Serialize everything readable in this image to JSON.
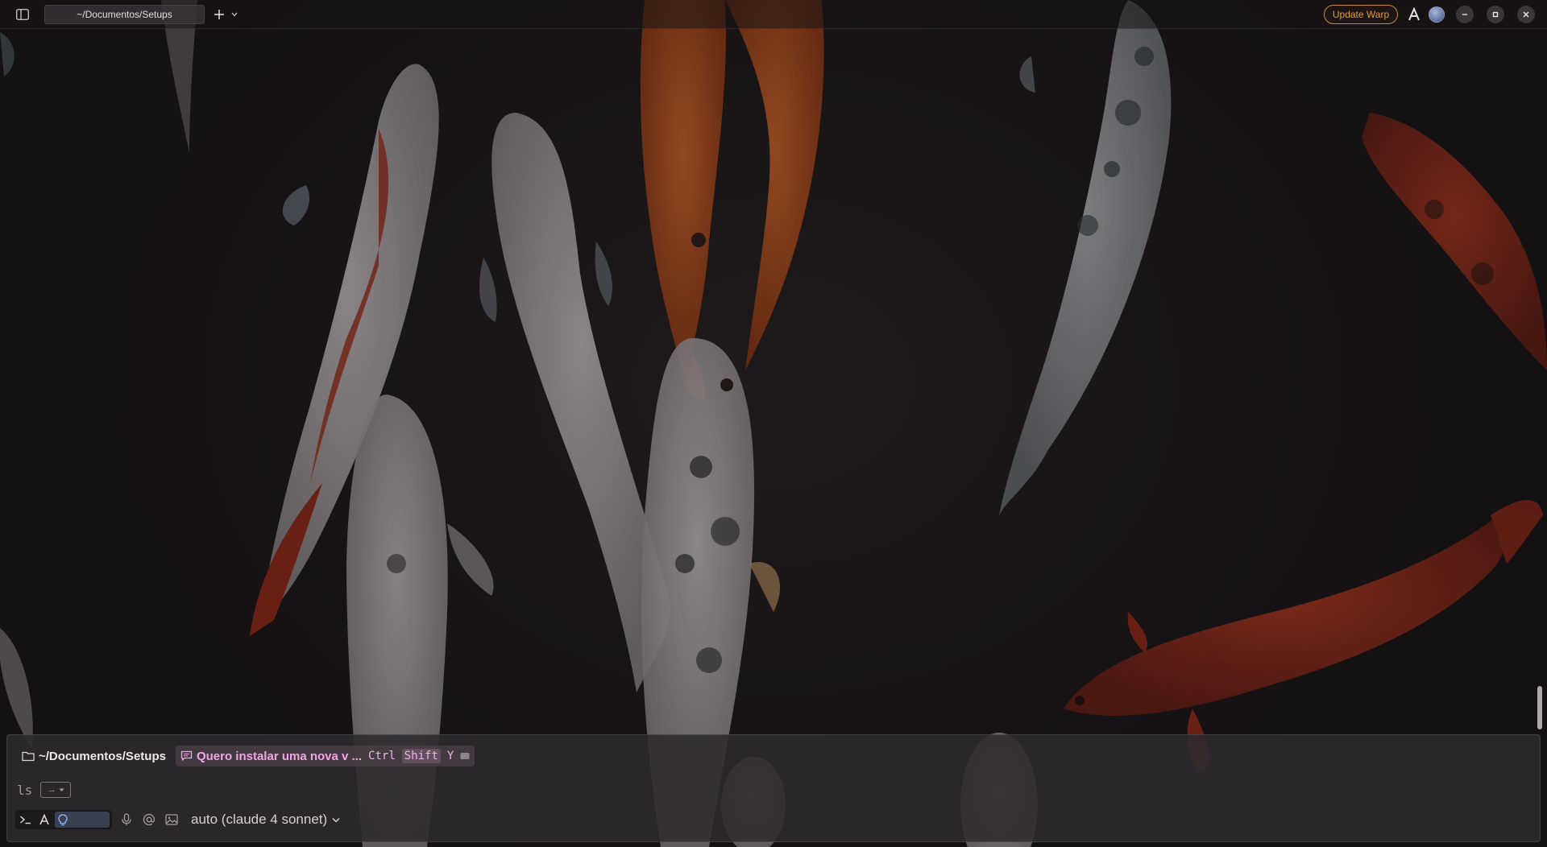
{
  "titlebar": {
    "tab_title": "~/Documentos/Setups",
    "update_label": "Update Warp"
  },
  "input": {
    "directory": "~/Documentos/Setups",
    "conversation_title": "Quero instalar uma nova v ...",
    "shortcut_keys": [
      "Ctrl",
      "Shift",
      "Y"
    ],
    "command_suggestion": "ls",
    "accept_arrow": "→",
    "model_label": "auto (claude 4 sonnet)"
  },
  "colors": {
    "accent_update": "#e39a3a",
    "conversation_pink": "#f0a6e6"
  },
  "icons": {
    "sidebar": "sidebar-toggle-icon",
    "new_tab": "plus-icon",
    "folder": "folder-icon",
    "chat": "chat-bubble-icon",
    "terminal": "terminal-prompt-icon",
    "agent": "warp-agent-icon",
    "idea": "lightbulb-icon",
    "mic": "microphone-icon",
    "mention": "at-sign-icon",
    "image": "image-attach-icon"
  }
}
